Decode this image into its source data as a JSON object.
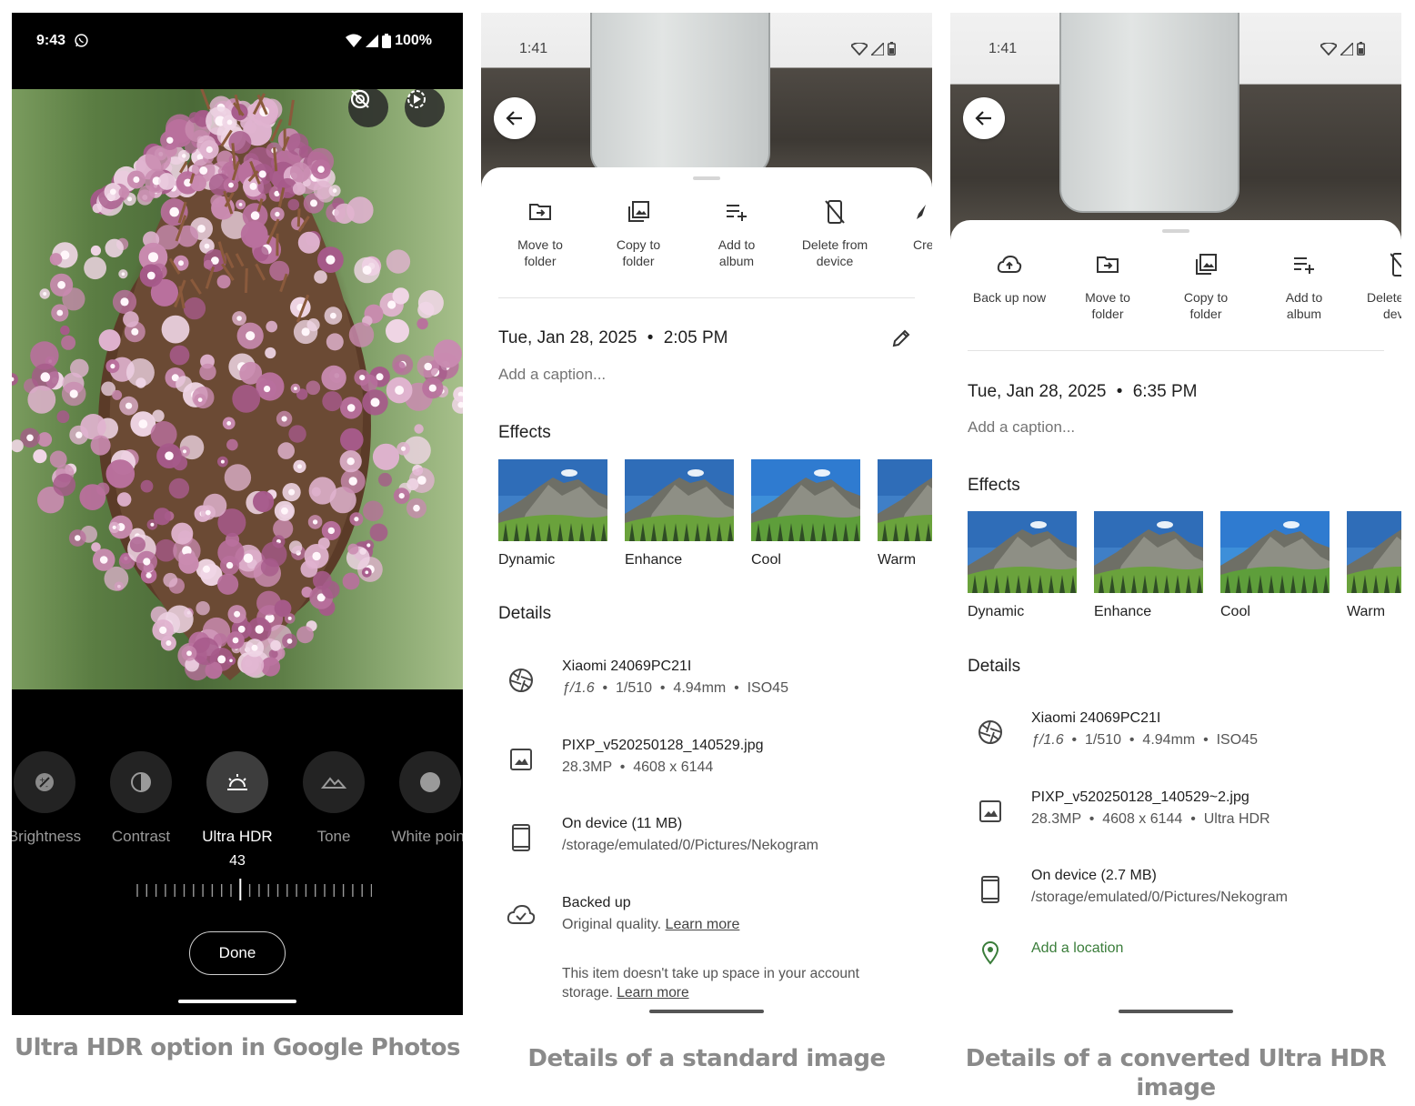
{
  "panel1": {
    "status": {
      "time": "9:43",
      "battery": "100%"
    },
    "tools": [
      {
        "label": "Brightness",
        "icon": "brightness-icon"
      },
      {
        "label": "Contrast",
        "icon": "contrast-icon"
      },
      {
        "label": "Ultra HDR",
        "icon": "ultra-hdr-icon",
        "selected": true
      },
      {
        "label": "Tone",
        "icon": "tone-icon"
      },
      {
        "label": "White point",
        "icon": "white-point-icon"
      }
    ],
    "slider_value": "43",
    "done_label": "Done",
    "caption": "Ultra HDR option in Google Photos"
  },
  "panel2": {
    "status": {
      "time": "1:41"
    },
    "actions": [
      {
        "label1": "Move to",
        "label2": "folder",
        "icon": "move-to-folder-icon"
      },
      {
        "label1": "Copy to",
        "label2": "folder",
        "icon": "copy-to-folder-icon"
      },
      {
        "label1": "Add to",
        "label2": "album",
        "icon": "add-to-album-icon"
      },
      {
        "label1": "Delete from",
        "label2": "device",
        "icon": "delete-from-device-icon"
      },
      {
        "label1": "Cre",
        "label2": "",
        "icon": "create-icon"
      }
    ],
    "date": "Tue, Jan 28, 2025",
    "time": "2:05 PM",
    "caption_placeholder": "Add a caption...",
    "effects_title": "Effects",
    "effects": [
      "Dynamic",
      "Enhance",
      "Cool",
      "Warm"
    ],
    "details_title": "Details",
    "camera": "Xiaomi 24069PC21I",
    "exif": {
      "aperture": "ƒ/1.6",
      "shutter": "1/510",
      "focal": "4.94mm",
      "iso": "ISO45"
    },
    "filename": "PIXP_v520250128_140529.jpg",
    "megapixels": "28.3MP",
    "resolution": "4608 x 6144",
    "storage": "On device (11 MB)",
    "path": "/storage/emulated/0/Pictures/Nekogram",
    "backup_title": "Backed up",
    "backup_quality": "Original quality.",
    "learn_more": "Learn more",
    "note_text": "This item doesn't take up space in your account storage.",
    "caption": "Details of a standard image"
  },
  "panel3": {
    "status": {
      "time": "1:41"
    },
    "actions": [
      {
        "label1": "Back up now",
        "label2": "",
        "icon": "backup-now-icon"
      },
      {
        "label1": "Move to",
        "label2": "folder",
        "icon": "move-to-folder-icon"
      },
      {
        "label1": "Copy to",
        "label2": "folder",
        "icon": "copy-to-folder-icon"
      },
      {
        "label1": "Add to",
        "label2": "album",
        "icon": "add-to-album-icon"
      },
      {
        "label1": "Delete",
        "label2": "dev",
        "icon": "delete-from-device-icon"
      }
    ],
    "date": "Tue, Jan 28, 2025",
    "time": "6:35 PM",
    "caption_placeholder": "Add a caption...",
    "effects_title": "Effects",
    "effects": [
      "Dynamic",
      "Enhance",
      "Cool",
      "Warm"
    ],
    "details_title": "Details",
    "camera": "Xiaomi 24069PC21I",
    "exif": {
      "aperture": "ƒ/1.6",
      "shutter": "1/510",
      "focal": "4.94mm",
      "iso": "ISO45"
    },
    "filename": "PIXP_v520250128_140529~2.jpg",
    "megapixels": "28.3MP",
    "resolution": "4608 x 6144",
    "hdr_tag": "Ultra HDR",
    "storage": "On device (2.7 MB)",
    "path": "/storage/emulated/0/Pictures/Nekogram",
    "add_location": "Add a location",
    "caption": "Details of a converted Ultra HDR image"
  },
  "colors": {
    "accent_green": "#3a7d3a",
    "caption_gray": "#8a8a8a"
  }
}
